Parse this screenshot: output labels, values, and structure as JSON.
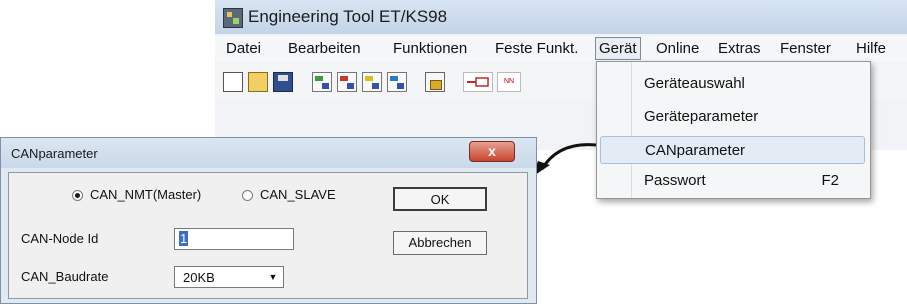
{
  "app": {
    "title": "Engineering Tool ET/KS98",
    "menu": [
      "Datei",
      "Bearbeiten",
      "Funktionen",
      "Feste Funkt.",
      "Gerät",
      "Online",
      "Extras",
      "Fenster",
      "Hilfe"
    ],
    "active_menu": "Gerät",
    "toolbar": {
      "icons": [
        "new-file-icon",
        "open-folder-icon",
        "save-icon",
        "signal-icon",
        "signal-icon",
        "signal-icon",
        "signal-icon",
        "lock-icon",
        "connector-icon",
        "nn-icon"
      ],
      "nn_label": "NN"
    }
  },
  "dropdown": {
    "items": [
      {
        "label": "Geräteauswahl",
        "shortcut": ""
      },
      {
        "label": "Geräteparameter",
        "shortcut": ""
      },
      {
        "label": "CANparameter",
        "shortcut": "",
        "highlighted": true
      },
      {
        "label": "Passwort",
        "shortcut": "F2"
      }
    ]
  },
  "dialog": {
    "title": "CANparameter",
    "close_label": "x",
    "radio_master_label": "CAN_NMT(Master)",
    "radio_slave_label": "CAN_SLAVE",
    "radio_selected": "CAN_NMT(Master)",
    "ok_label": "OK",
    "cancel_label": "Abbrechen",
    "node_id_label": "CAN-Node Id",
    "node_id_value": "1",
    "baudrate_label": "CAN_Baudrate",
    "baudrate_value": "20KB"
  },
  "colors": {
    "titlebar": "#c3d4e8",
    "close_button": "#c8452f",
    "highlight": "#e3ebf5"
  }
}
